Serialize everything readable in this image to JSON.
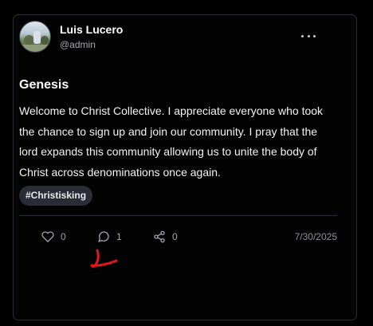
{
  "post": {
    "author_name": "Luis Lucero",
    "author_handle": "@admin",
    "title": "Genesis",
    "body": "Welcome to Christ Collective. I appreciate everyone who took the chance to sign up and join our community. I pray that the lord expands this community allowing us to unite the body of Christ across denominations once again.",
    "tag": "#Christisking",
    "date": "7/30/2025"
  },
  "actions": {
    "likes": "0",
    "comments": "1",
    "shares": "0"
  },
  "icons": {
    "more": "more-horizontal-icon",
    "like": "heart-icon",
    "comment": "comment-bubble-icon",
    "share": "share-icon"
  },
  "colors": {
    "background": "#000000",
    "card_border": "#2b2e36",
    "tag_bg": "#2a2d35",
    "muted_text": "#9ea3ab",
    "annotation": "#e01818"
  }
}
